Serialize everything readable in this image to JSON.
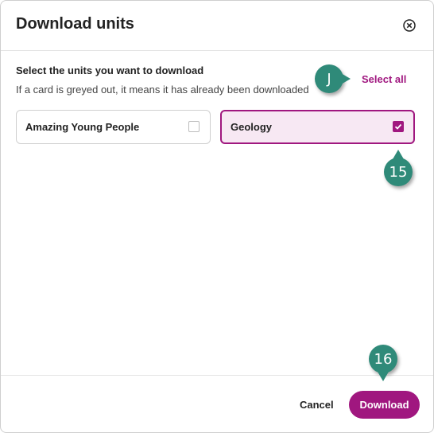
{
  "dialog": {
    "title": "Download units",
    "close_icon": "close-circle-icon",
    "prompt": "Select the units you want to download",
    "hint": "If a card is greyed out, it means it has already been downloaded",
    "select_all_label": "Select all",
    "units": [
      {
        "label": "Amazing Young People",
        "checked": false
      },
      {
        "label": "Geology",
        "checked": true
      }
    ],
    "footer": {
      "cancel_label": "Cancel",
      "download_label": "Download"
    }
  },
  "markers": {
    "j": "J",
    "m15": "15",
    "m16": "16"
  },
  "colors": {
    "accent": "#a0177f",
    "selected_bg": "#f7e8f3",
    "marker": "#2f8a79"
  }
}
